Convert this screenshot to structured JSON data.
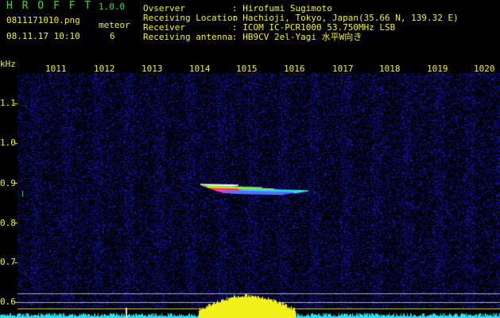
{
  "header": {
    "app_title": "H R O F F T",
    "version": "1.0.0",
    "filename": "0811171010.png",
    "datetime": "08.11.17 10:10",
    "meteor_label": "meteor",
    "meteor_count": "6",
    "info_labels": [
      "Ovserver",
      "Receiving Location",
      "Receiver",
      "Receiving antenna"
    ],
    "info_values": [
      ": Hirofumi Sugimoto",
      ": Hachioji, Tokyo, Japan(35.66 N, 139.32 E)",
      ": ICOM IC-PCR1000 53.750MHz LSB",
      ": HB9CV 2el-Yagi 水平W向き"
    ]
  },
  "axes": {
    "y_unit": "kHz",
    "y_ticks": [
      "1.1",
      "1.0",
      "0.9",
      "0.8",
      "0.7",
      "0.6"
    ],
    "x_ticks": [
      "1011",
      "1012",
      "1013",
      "1014",
      "1015",
      "1016",
      "1017",
      "1018",
      "1019",
      "1020"
    ]
  },
  "colors": {
    "background": "#000000",
    "noise": "#1a1aa0",
    "accent_green": "#2ee02e",
    "accent_yellow": "#f2f21a",
    "signal_cyan": "#22e6f0"
  }
}
